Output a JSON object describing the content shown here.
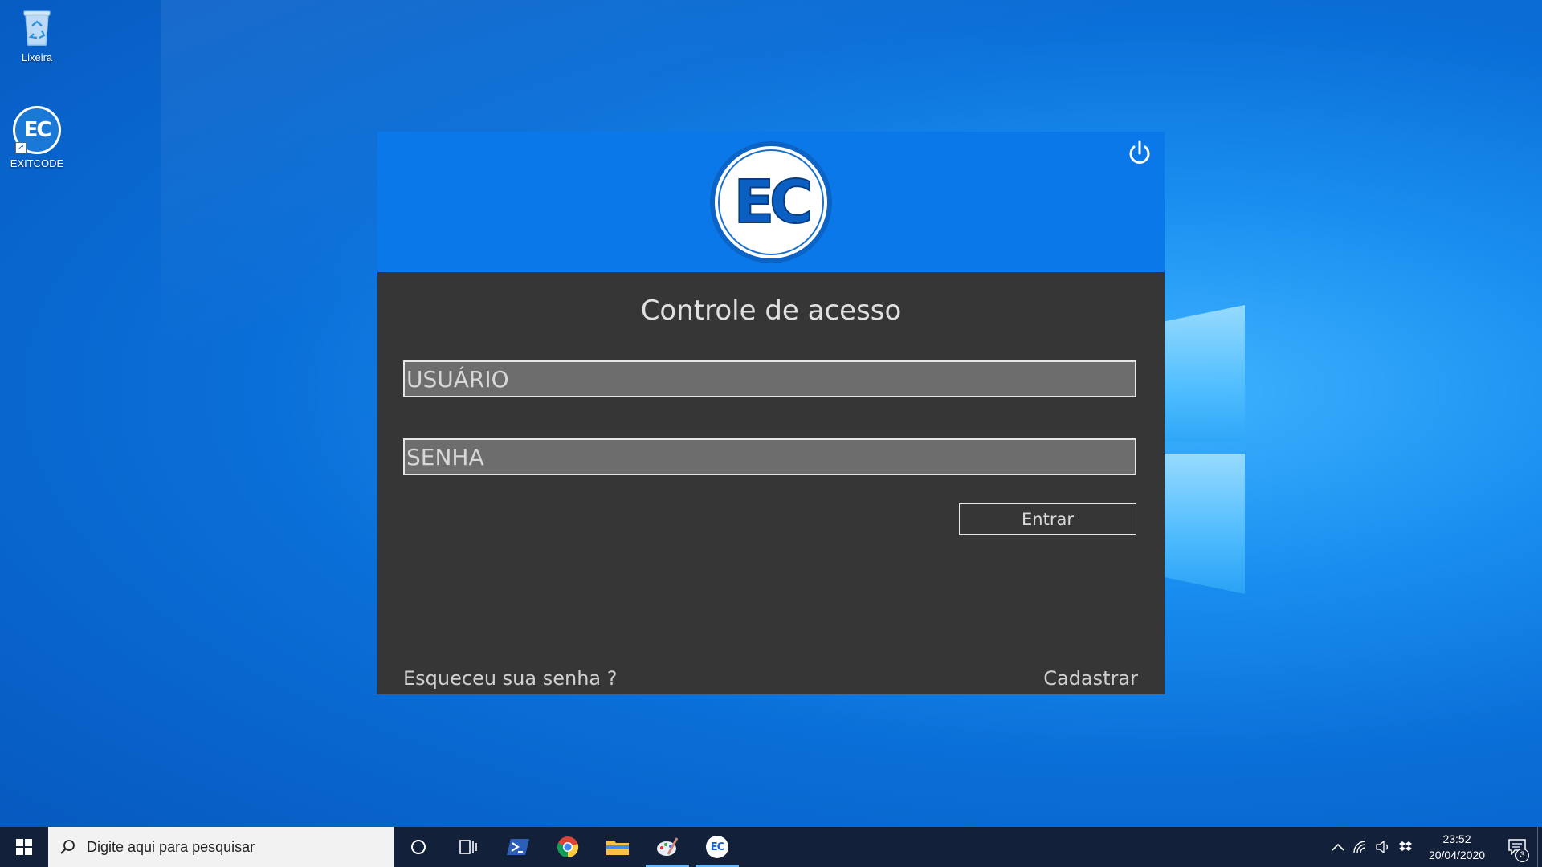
{
  "desktop": {
    "icons": [
      {
        "label": "Lixeira",
        "icon": "recycle-bin-icon"
      },
      {
        "label": "EXITCODE",
        "icon": "exitcode-app-icon",
        "glyph": "EC"
      }
    ]
  },
  "app": {
    "logo_text": "EC",
    "title": "Controle de acesso",
    "username_placeholder": "USUÁRIO",
    "password_placeholder": "SENHA",
    "submit_label": "Entrar",
    "forgot_link": "Esqueceu sua senha ?",
    "register_link": "Cadastrar",
    "colors": {
      "header": "#0a78e8",
      "body": "#363636",
      "field": "#6d6d6d"
    }
  },
  "taskbar": {
    "search_placeholder": "Digite aqui para pesquisar",
    "apps": [
      "cortana-icon",
      "task-view-icon",
      "powershell-icon",
      "chrome-icon",
      "file-explorer-icon",
      "paint-icon",
      "exitcode-app-icon"
    ],
    "ec_glyph": "EC",
    "clock": {
      "time": "23:52",
      "date": "20/04/2020"
    },
    "notification_count": "3"
  }
}
